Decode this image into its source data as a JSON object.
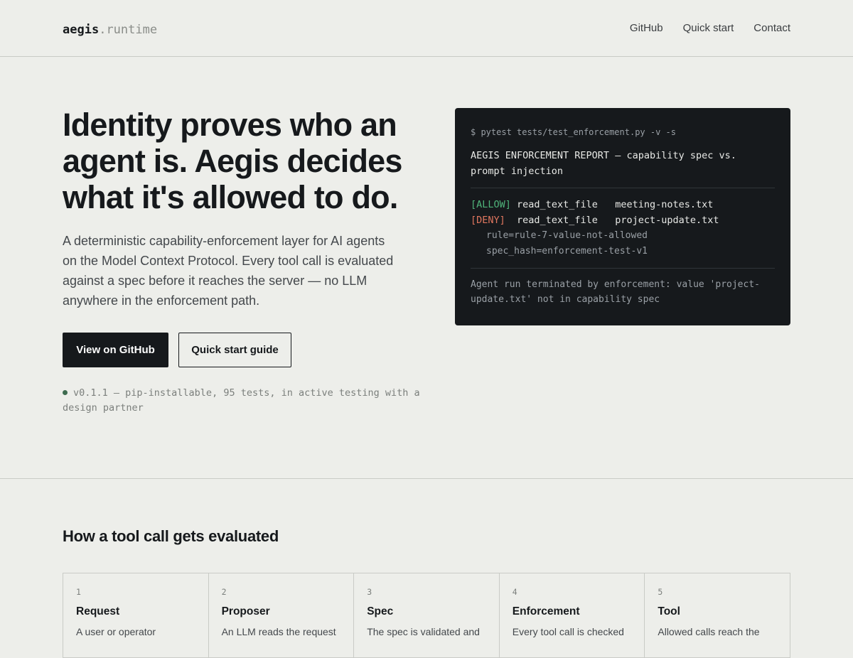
{
  "header": {
    "logo_main": "aegis",
    "logo_dot": ".",
    "logo_sub": "runtime",
    "nav": [
      "GitHub",
      "Quick start",
      "Contact"
    ]
  },
  "hero": {
    "title": "Identity proves who an agent is. Aegis decides what it's allowed to do.",
    "description": "A deterministic capability-enforcement layer for AI agents on the Model Context Protocol. Every tool call is evaluated against a spec before it reaches the server — no LLM anywhere in the enforcement path.",
    "primary_button": "View on GitHub",
    "secondary_button": "Quick start guide",
    "status": "v0.1.1 — pip-installable, 95 tests, in active testing with a design partner"
  },
  "terminal": {
    "command": "$ pytest tests/test_enforcement.py -v -s",
    "report_title": "AEGIS ENFORCEMENT REPORT — capability spec vs. prompt injection",
    "rows": [
      {
        "tag": "[ALLOW]",
        "tool": "read_text_file",
        "arg": "meeting-notes.txt"
      },
      {
        "tag": "[DENY]",
        "tool": "read_text_file",
        "arg": "project-update.txt"
      }
    ],
    "meta": [
      "rule=rule-7-value-not-allowed",
      "spec_hash=enforcement-test-v1"
    ],
    "footer": "Agent run terminated by enforcement: value 'project-update.txt' not in capability spec"
  },
  "section": {
    "title": "How a tool call gets evaluated",
    "steps": [
      {
        "num": "1",
        "title": "Request",
        "desc": "A user or operator"
      },
      {
        "num": "2",
        "title": "Proposer",
        "desc": "An LLM reads the request"
      },
      {
        "num": "3",
        "title": "Spec",
        "desc": "The spec is validated and"
      },
      {
        "num": "4",
        "title": "Enforcement",
        "desc": "Every tool call is checked"
      },
      {
        "num": "5",
        "title": "Tool",
        "desc": "Allowed calls reach the"
      }
    ]
  },
  "colors": {
    "background": "#edeeea",
    "ink": "#16191c",
    "terminal_bg": "#16191c",
    "allow": "#4fb37a",
    "deny": "#e0765f",
    "status_dot": "#3d6b4f"
  }
}
